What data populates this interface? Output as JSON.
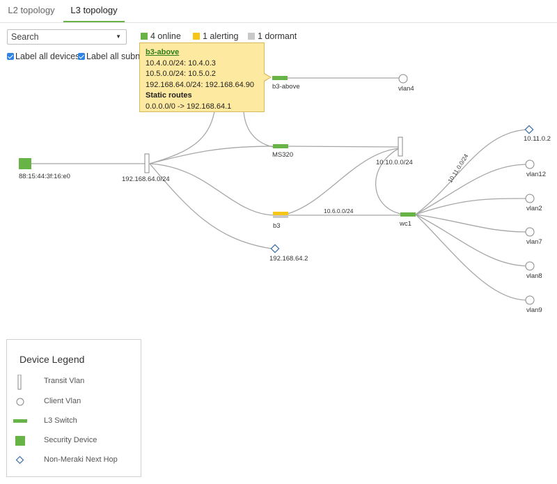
{
  "tabs": [
    {
      "label": "L2 topology",
      "active": false
    },
    {
      "label": "L3 topology",
      "active": true
    }
  ],
  "search": {
    "value": "Search"
  },
  "status": {
    "online": "4 online",
    "alerting": "1 alerting",
    "dormant": "1 dormant",
    "colors": {
      "online": "#67b346",
      "alerting": "#f5c518",
      "dormant": "#c8c8c8"
    }
  },
  "options": {
    "label_devices": "Label all devices.",
    "label_subnets": "Label all subne",
    "label_devices_checked": true,
    "label_subnets_checked": true
  },
  "tooltip": {
    "title": "b3-above",
    "lines": [
      "10.4.0.0/24: 10.4.0.3",
      "10.5.0.0/24: 10.5.0.2",
      "192.168.64.0/24: 192.168.64.90"
    ],
    "routes_heading": "Static routes",
    "routes": [
      "0.0.0.0/0 -> 192.168.64.1"
    ]
  },
  "topology": {
    "nodes": {
      "security": "88:15:44:3f:16:e0",
      "transit_main": "192.168.64.0/24",
      "b3_above": "b3-above",
      "vlan4": "vlan4",
      "ms320": "MS320",
      "transit_right": "10.10.0.0/24",
      "b3": "b3",
      "nexthop_bottom": "192.168.64.2",
      "wc1": "wc1",
      "nexthop_right": "10.11.0.2",
      "vlan12": "vlan12",
      "vlan2": "vlan2",
      "vlan7": "vlan7",
      "vlan8": "vlan8",
      "vlan9": "vlan9"
    },
    "edge_labels": {
      "b3_wc1": "10.6.0.0/24",
      "wc1_nexthop": "10.11.0.0/24"
    }
  },
  "legend": {
    "title": "Device Legend",
    "items": [
      {
        "label": "Transit Vlan",
        "icon": "transit-vlan-icon"
      },
      {
        "label": "Client Vlan",
        "icon": "client-vlan-icon"
      },
      {
        "label": "L3 Switch",
        "icon": "l3-switch-icon"
      },
      {
        "label": "Security Device",
        "icon": "security-device-icon"
      },
      {
        "label": "Non-Meraki Next Hop",
        "icon": "next-hop-icon"
      }
    ]
  }
}
